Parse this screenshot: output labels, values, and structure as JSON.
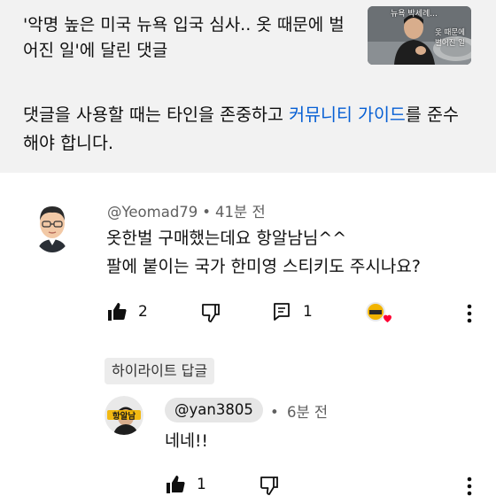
{
  "video": {
    "title": "'악명 높은 미국 뉴욕 입국 심사.. 옷 때문에 벌어진 일'에 달린 댓글",
    "thumbnail_caption_1": "뉴욕 박세례...",
    "thumbnail_caption_2": "옷 때문에",
    "thumbnail_caption_3": "벌어진 일"
  },
  "guidelines": {
    "text_before": "댓글을 사용할 때는 타인을 존중하고 ",
    "link_text": "커뮤니티 가이드",
    "text_after": "를 준수해야 합니다."
  },
  "comment": {
    "author": "@Yeomad79",
    "separator": "•",
    "time": "41분 전",
    "line1": "옷한벌 구매했는데요 항알남님^^",
    "line2": "팔에 붙이는 국가 한미영 스티키도 주시나요?",
    "like_count": "2",
    "reply_count": "1",
    "heart_icon": "creator-heart-icon"
  },
  "highlight": {
    "badge": "하이라이트 답글"
  },
  "reply": {
    "author": "@yan3805",
    "separator": "•",
    "time": "6분 전",
    "text": "네네!!",
    "like_count": "1",
    "avatar_text": "항알남"
  },
  "colors": {
    "link": "#065fd4",
    "heart": "#ff0033",
    "top_background": "#f2f2f2",
    "chip_background": "#e6e6e6"
  }
}
